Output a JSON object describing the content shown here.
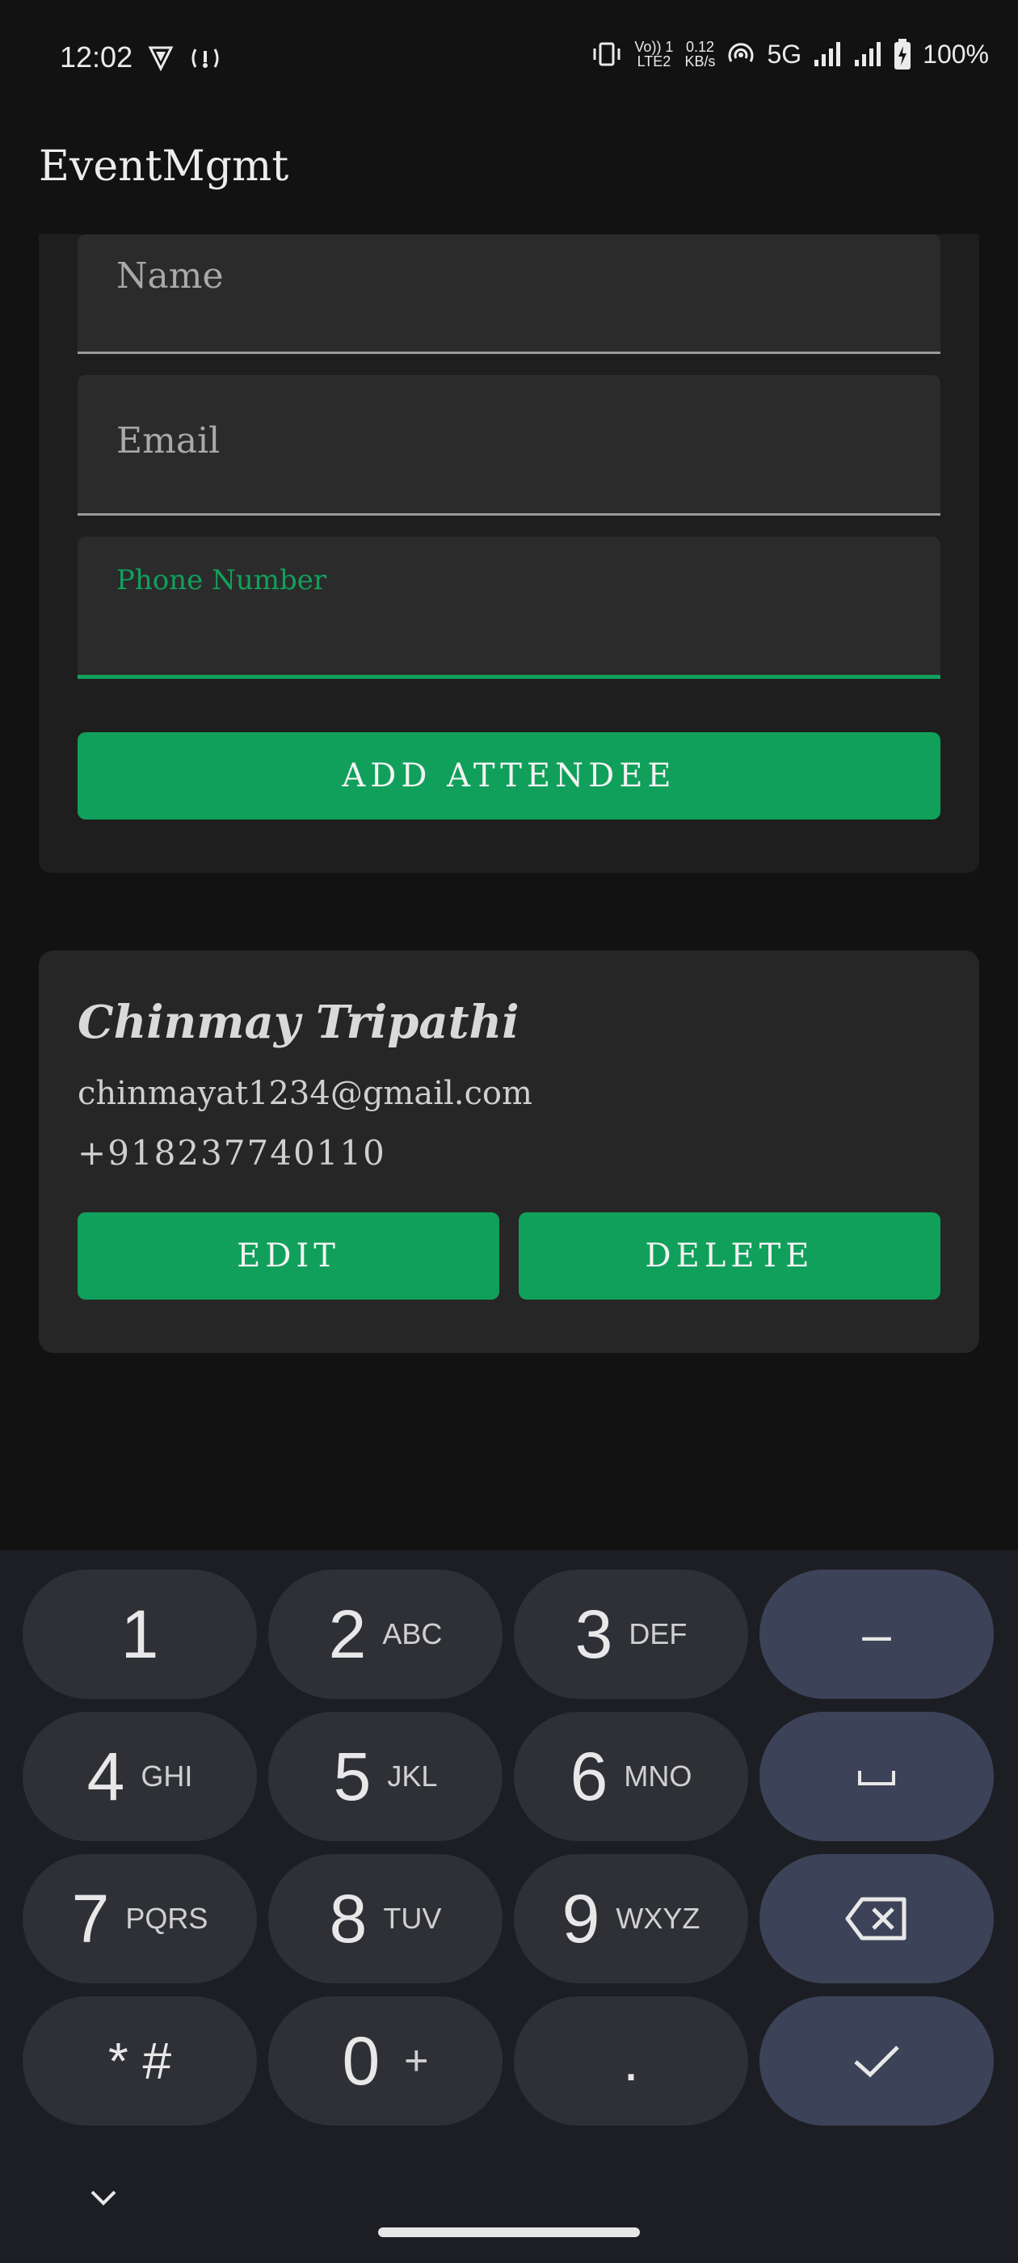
{
  "status_bar": {
    "time": "12:02",
    "net_top": "Vo)) 1",
    "net_bottom": "LTE2",
    "speed_top": "0.12",
    "speed_bottom": "KB/s",
    "network": "5G",
    "battery": "100%"
  },
  "app_bar": {
    "title": "EventMgmt"
  },
  "form": {
    "name_label": "Name",
    "email_label": "Email",
    "phone_label": "Phone Number",
    "phone_value": "",
    "add_button": "ADD ATTENDEE",
    "accent_color": "#11a05b"
  },
  "attendees": [
    {
      "name": "Chinmay Tripathi",
      "email": "chinmayat1234@gmail.com",
      "phone": "+918237740110",
      "edit_label": "EDIT",
      "delete_label": "DELETE"
    }
  ],
  "keyboard": {
    "keys": [
      {
        "digit": "1",
        "letters": ""
      },
      {
        "digit": "2",
        "letters": "ABC"
      },
      {
        "digit": "3",
        "letters": "DEF"
      },
      {
        "symbol": "–"
      },
      {
        "digit": "4",
        "letters": "GHI"
      },
      {
        "digit": "5",
        "letters": "JKL"
      },
      {
        "digit": "6",
        "letters": "MNO"
      },
      {
        "symbol": "␣"
      },
      {
        "digit": "7",
        "letters": "PQRS"
      },
      {
        "digit": "8",
        "letters": "TUV"
      },
      {
        "digit": "9",
        "letters": "WXYZ"
      },
      {
        "symbol": "backspace"
      },
      {
        "digit": "* #",
        "letters": ""
      },
      {
        "digit": "0",
        "letters": "+"
      },
      {
        "digit": ".",
        "letters": ""
      },
      {
        "symbol": "check"
      }
    ]
  }
}
